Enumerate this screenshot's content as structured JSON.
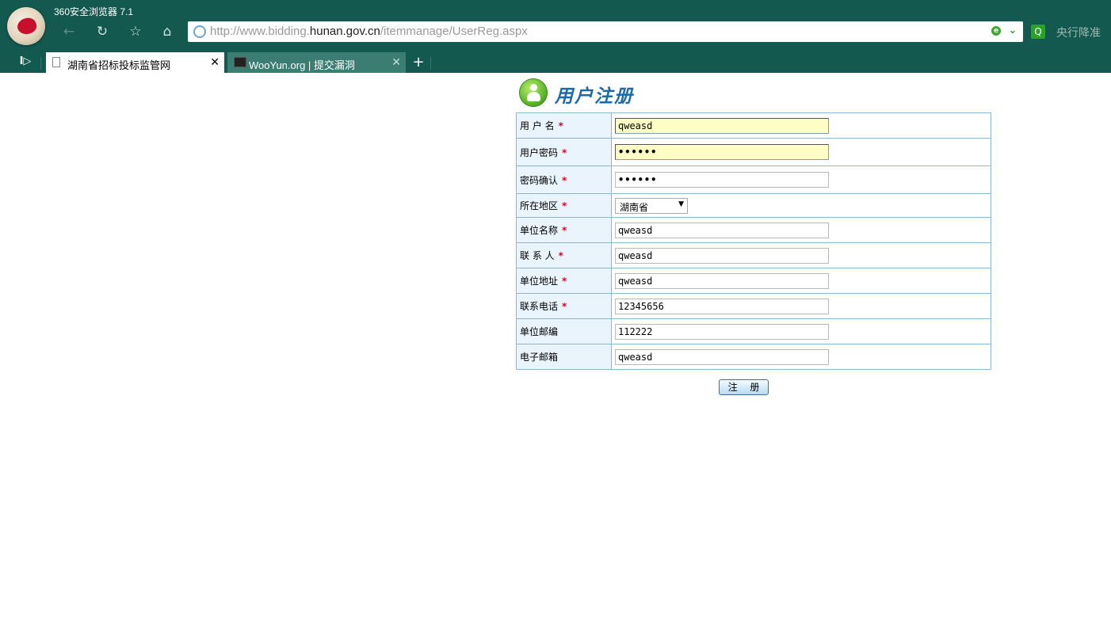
{
  "browser": {
    "title": "360安全浏览器 7.1",
    "url_prefix": "http://www.bidding.",
    "url_domain": "hunan.gov.cn",
    "url_path": "/itemmanage/UserReg.aspx",
    "search_placeholder": "央行降准",
    "tabs": [
      {
        "label": "湖南省招标投标监管网",
        "close": "✕"
      },
      {
        "label": "WooYun.org | 提交漏洞",
        "close": "✕"
      }
    ],
    "new_tab": "+",
    "icons": {
      "back": "←",
      "reload": "↻",
      "favorite": "☆",
      "home": "⌂",
      "sidebar": "I▷",
      "url_drop": "⌄"
    }
  },
  "page": {
    "heading": "用户注册",
    "fields": [
      {
        "label": "用 户 名",
        "required": "*",
        "value": "qweasd"
      },
      {
        "label": "用户密码",
        "required": "*",
        "value": "••••••"
      },
      {
        "label": "密码确认",
        "required": "*",
        "value": "••••••"
      },
      {
        "label": "所在地区",
        "required": "*",
        "value": "湖南省"
      },
      {
        "label": "单位名称",
        "required": "*",
        "value": "qweasd"
      },
      {
        "label": "联 系 人",
        "required": "*",
        "value": "qweasd"
      },
      {
        "label": "单位地址",
        "required": "*",
        "value": "qweasd"
      },
      {
        "label": "联系电话",
        "required": "*",
        "value": "12345656"
      },
      {
        "label": "单位邮编",
        "value": "112222"
      },
      {
        "label": "电子邮箱",
        "value": "qweasd"
      }
    ],
    "submit_label": "注 册"
  },
  "colors": {
    "chrome": "#13594f",
    "accent": "#1d6aa6",
    "required": "#e0002a",
    "highlight": "#fffec4"
  }
}
